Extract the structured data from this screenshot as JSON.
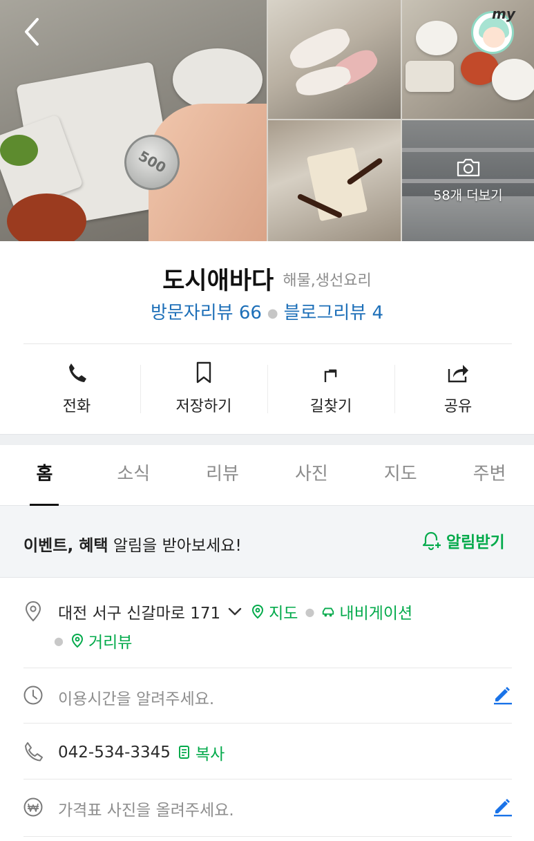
{
  "header": {
    "more_photos_label": "58개 더보기",
    "profile_badge": "my",
    "coin_text": "500"
  },
  "place": {
    "name": "도시애바다",
    "category": "해물,생선요리",
    "visitor_reviews": "방문자리뷰 66",
    "blog_reviews": "블로그리뷰 4"
  },
  "actions": [
    {
      "label": "전화",
      "icon": "phone-icon"
    },
    {
      "label": "저장하기",
      "icon": "bookmark-icon"
    },
    {
      "label": "길찾기",
      "icon": "directions-icon"
    },
    {
      "label": "공유",
      "icon": "share-icon"
    }
  ],
  "tabs": [
    {
      "label": "홈",
      "active": true
    },
    {
      "label": "소식",
      "active": false
    },
    {
      "label": "리뷰",
      "active": false
    },
    {
      "label": "사진",
      "active": false
    },
    {
      "label": "지도",
      "active": false
    },
    {
      "label": "주변",
      "active": false
    }
  ],
  "banner": {
    "bold_text": "이벤트, 혜택",
    "text": " 알림을 받아보세요!",
    "button": "알림받기"
  },
  "info": {
    "address": "대전 서구 신갈마로 171",
    "map_link": "지도",
    "navi_link": "내비게이션",
    "street_view_link": "거리뷰",
    "hours_placeholder": "이용시간을 알려주세요.",
    "phone": "042-534-3345",
    "copy_link": "복사",
    "price_placeholder": "가격표 사진을 올려주세요."
  },
  "colors": {
    "accent_green": "#03aa4b",
    "review_blue": "#1d6fb8",
    "edit_blue": "#1a73e8"
  }
}
